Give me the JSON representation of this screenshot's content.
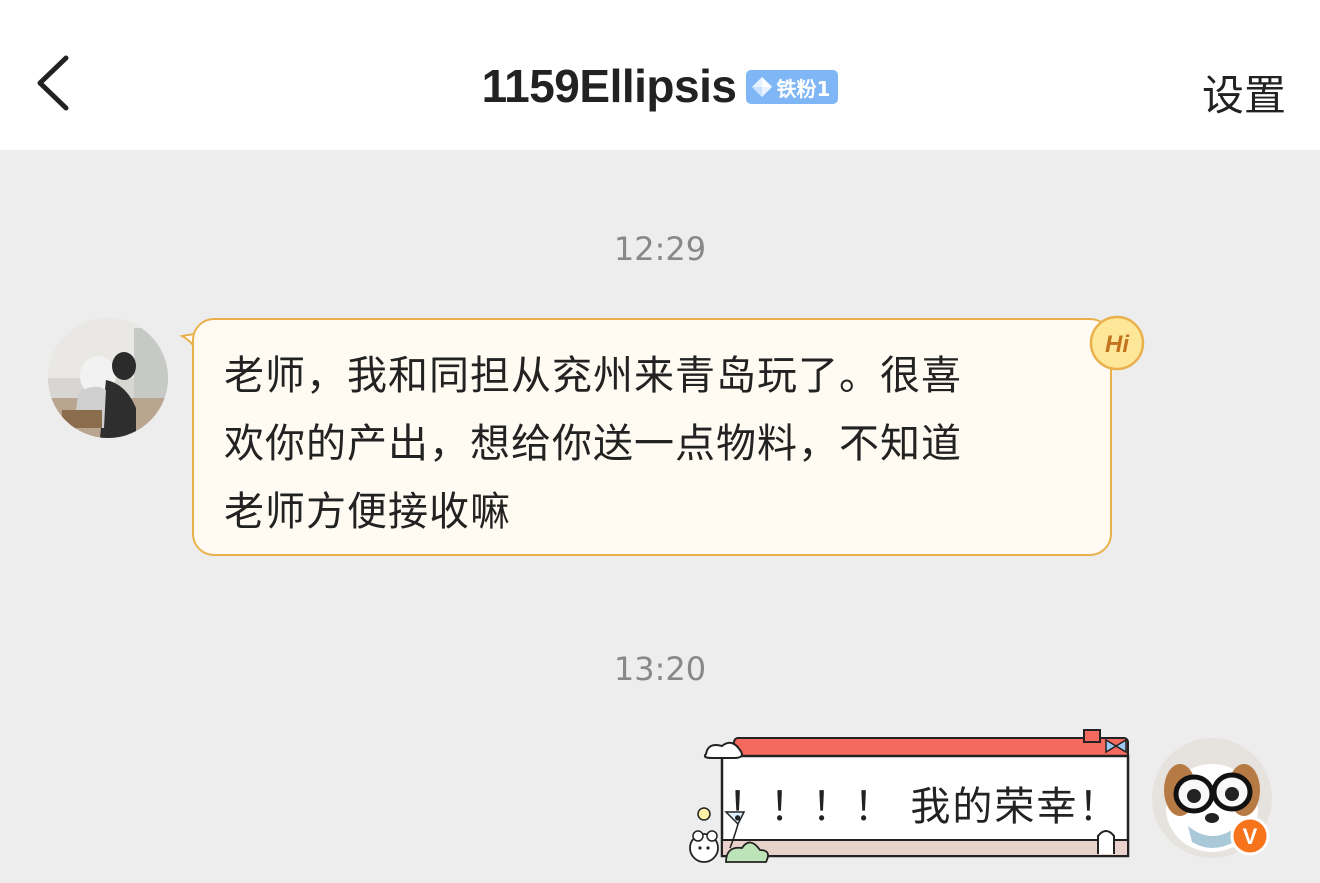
{
  "header": {
    "title": "1159Ellipsis",
    "badge_label": "铁粉1",
    "settings_label": "设置",
    "icons": {
      "back": "chevron-left-icon",
      "badge": "diamond-icon"
    }
  },
  "messages": [
    {
      "time": "12:29",
      "side": "left",
      "text": "老师，我和同担从兖州来青岛玩了。很喜欢你的产出，想给你送一点物料，不知道老师方便接收嘛",
      "lines": [
        "老师，我和同担从兖州来青岛玩了。很喜",
        "欢你的产出，想给你送一点物料，不知道",
        "老师方便接收嘛"
      ],
      "sticker_label": "Hi"
    },
    {
      "time": "13:20",
      "side": "right",
      "text": "！！！！ 我的荣幸！",
      "verified_label": "V"
    }
  ],
  "colors": {
    "badge_bg": "#7fb6f6",
    "bubble_border": "#e9b04c",
    "bubble_bg": "#fffbf2",
    "roof_red": "#f46a5e",
    "verified_orange": "#f7741d"
  }
}
